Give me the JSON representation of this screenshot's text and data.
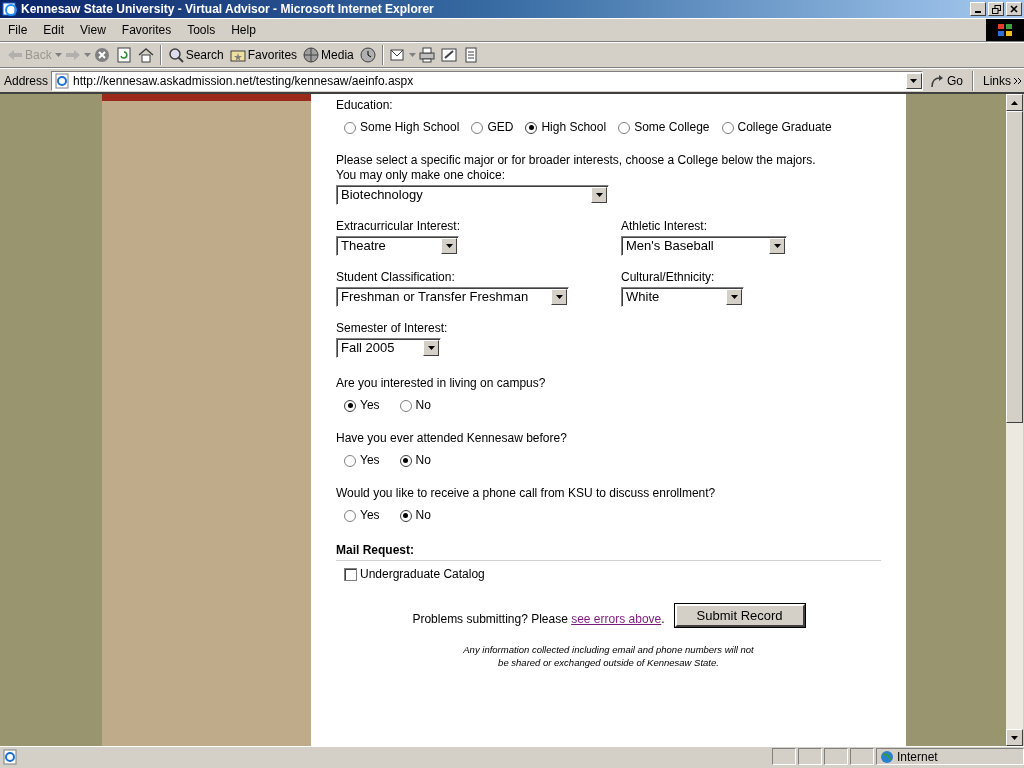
{
  "window": {
    "title": "Kennesaw State University - Virtual Advisor - Microsoft Internet Explorer"
  },
  "menu": [
    "File",
    "Edit",
    "View",
    "Favorites",
    "Tools",
    "Help"
  ],
  "toolbar": [
    {
      "kind": "back",
      "label": "Back",
      "disabled": true
    },
    {
      "kind": "forward",
      "disabled": true
    },
    {
      "kind": "stop",
      "disabled": false
    },
    {
      "kind": "refresh",
      "disabled": false
    },
    {
      "kind": "home",
      "disabled": false
    },
    {
      "kind": "search",
      "label": "Search",
      "disabled": false
    },
    {
      "kind": "favorites",
      "label": "Favorites",
      "disabled": false
    },
    {
      "kind": "media",
      "label": "Media",
      "disabled": false
    },
    {
      "kind": "history",
      "disabled": false
    },
    {
      "kind": "mail",
      "disabled": false
    },
    {
      "kind": "print",
      "disabled": false
    },
    {
      "kind": "edit",
      "disabled": false
    },
    {
      "kind": "discuss",
      "disabled": false
    }
  ],
  "address_bar": {
    "label": "Address",
    "url": "http://kennesaw.askadmission.net/testing/kennesaw/aeinfo.aspx",
    "go": "Go",
    "links": "Links"
  },
  "form": {
    "education": {
      "label": "Education:",
      "options": [
        {
          "label": "Some High School",
          "selected": false
        },
        {
          "label": "GED",
          "selected": false
        },
        {
          "label": "High School",
          "selected": true
        },
        {
          "label": "Some College",
          "selected": false
        },
        {
          "label": "College Graduate",
          "selected": false
        }
      ]
    },
    "major": {
      "lines": [
        "Please select a specific major or for broader interests, choose a College below the majors.",
        "You may only make one choice:"
      ],
      "value": "Biotechnology"
    },
    "dropdown_rows": [
      {
        "fields": [
          {
            "label": "Extracurricular Interest:",
            "value": "Theatre"
          },
          {
            "label": "Athletic Interest:",
            "value": "Men's Baseball"
          }
        ]
      },
      {
        "fields": [
          {
            "label": "Student Classification:",
            "value": "Freshman or Transfer Freshman"
          },
          {
            "label": "Cultural/Ethnicity:",
            "value": "White"
          }
        ]
      },
      {
        "fields": [
          {
            "label": "Semester of Interest:",
            "value": "Fall 2005"
          }
        ]
      }
    ],
    "questions": [
      {
        "label": "Are you interested in living on campus?",
        "options": [
          {
            "label": "Yes",
            "selected": true
          },
          {
            "label": "No",
            "selected": false
          }
        ]
      },
      {
        "label": "Have you ever attended Kennesaw before?",
        "options": [
          {
            "label": "Yes",
            "selected": false
          },
          {
            "label": "No",
            "selected": true
          }
        ]
      },
      {
        "label": "Would you like to receive a phone call from KSU to discuss enrollment?",
        "options": [
          {
            "label": "Yes",
            "selected": false
          },
          {
            "label": "No",
            "selected": true
          }
        ]
      }
    ],
    "mail_request": {
      "heading": "Mail Request:",
      "items": [
        {
          "label": "Undergraduate Catalog",
          "checked": false
        }
      ]
    },
    "submit_note": {
      "prefix": "Problems submitting? Please ",
      "link": "see errors above",
      "suffix": "."
    },
    "submit_button": "Submit Record",
    "disclaimer": [
      "Any information collected including email and phone numbers will not",
      "be shared or exchanged outside of Kennesaw State."
    ]
  },
  "status_bar": {
    "zone": "Internet"
  }
}
